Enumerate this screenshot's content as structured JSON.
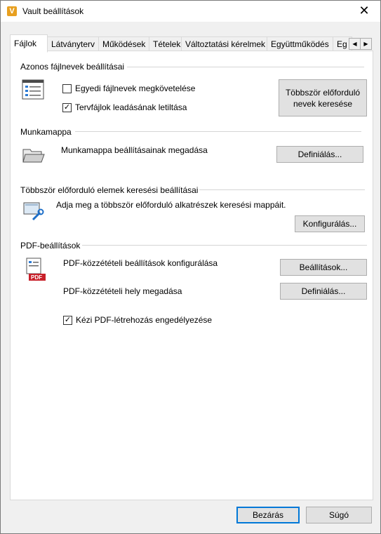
{
  "window": {
    "title": "Vault beállítások",
    "logo_letter": "V",
    "close_glyph": "✕"
  },
  "tabs": [
    {
      "label": "Fájlok",
      "active": true
    },
    {
      "label": "Látványterv"
    },
    {
      "label": "Működések"
    },
    {
      "label": "Tételek"
    },
    {
      "label": "Változtatási kérelmek"
    },
    {
      "label": "Együttműködés"
    },
    {
      "label": "Eg"
    }
  ],
  "tab_scroll": {
    "left": "◀",
    "right": "▶"
  },
  "groups": {
    "names": {
      "title": "Azonos fájlnevek beállításai",
      "require_unique_label": "Egyedi fájlnevek megkövetelése",
      "require_unique_checked": false,
      "disable_checkin_label": "Tervfájlok leadásának letiltása",
      "disable_checkin_checked": true,
      "find_duplicates_button": "Többször előforduló\nnevek keresése"
    },
    "workspace": {
      "title": "Munkamappa",
      "description": "Munkamappa beállításainak megadása",
      "define_button": "Definiálás..."
    },
    "duplicates": {
      "title": "Többször előforduló elemek keresési beállításai",
      "description": "Adja meg a többször előforduló alkatrészek keresési mappáit.",
      "configure_button": "Konfigurálás..."
    },
    "pdf": {
      "title": "PDF-beállítások",
      "publish_label": "PDF-közzétételi beállítások konfigurálása",
      "settings_button": "Beállítások...",
      "location_label": "PDF-közzétételi hely megadása",
      "define_button": "Definiálás...",
      "manual_label": "Kézi PDF-létrehozás engedélyezése",
      "manual_checked": true,
      "icon_text": "PDF"
    }
  },
  "footer": {
    "close_button": "Bezárás",
    "help_button": "Súgó"
  }
}
